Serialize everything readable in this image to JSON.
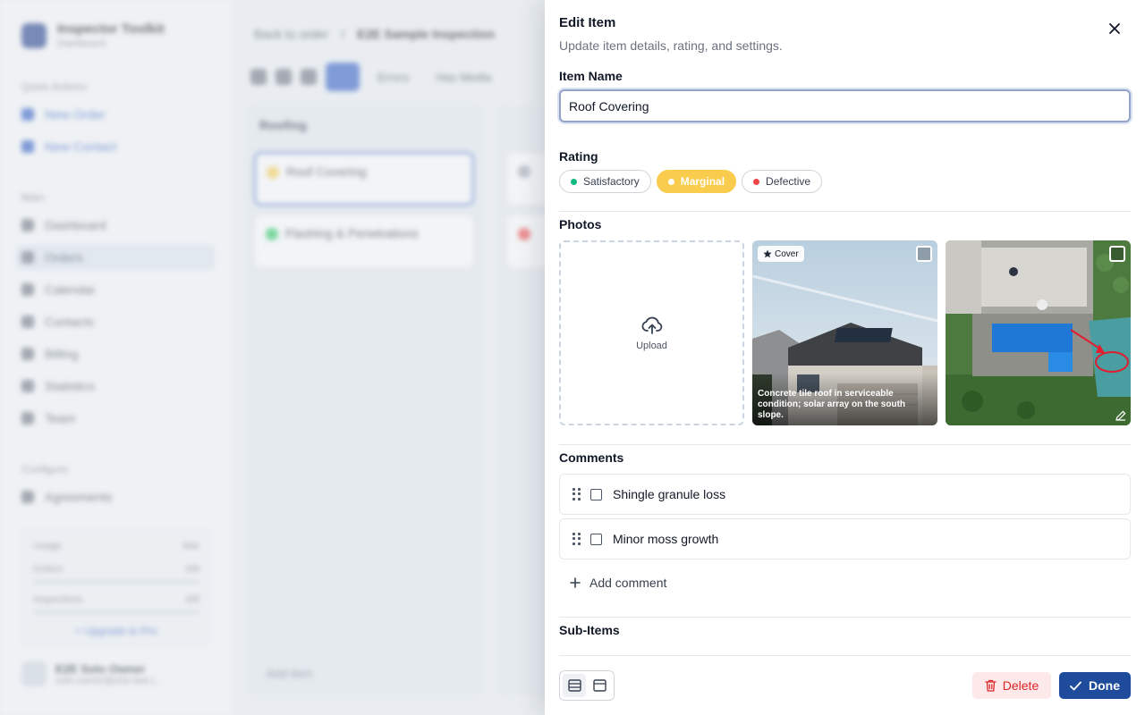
{
  "background": {
    "brand": {
      "title": "Inspector Toolkit",
      "subtitle": "Dashboard"
    },
    "quick_actions_label": "Quick Actions",
    "quick_actions": [
      "New Order",
      "New Contact"
    ],
    "main_label": "Main",
    "nav": [
      "Dashboard",
      "Orders",
      "Calendar",
      "Contacts",
      "Billing",
      "Statistics",
      "Team"
    ],
    "configure_label": "Configure",
    "configure": [
      "Agreements"
    ],
    "usage": {
      "label": "Usage",
      "period": "Mar",
      "rows": [
        [
          "Orders",
          "8/8"
        ],
        [
          "Inspections",
          "8/8"
        ]
      ],
      "upgrade": "+ Upgrade to Pro"
    },
    "user": {
      "name": "E2E Solo Owner",
      "email": "solo-owner@e2e-test.i..."
    },
    "breadcrumb": {
      "back": "Back to order",
      "current": "E2E Sample Inspection"
    },
    "toolbar": {
      "filters": "Errors",
      "media": "Has Media"
    },
    "columns": [
      {
        "title": "Roofing",
        "cards": [
          {
            "label": "Roof Covering",
            "color": "#facc4d"
          },
          {
            "label": "Flashing & Penetrations",
            "color": "#22c55e"
          }
        ]
      }
    ],
    "add_item": "Add item"
  },
  "drawer": {
    "title": "Edit Item",
    "subtitle": "Update item details, rating, and settings.",
    "item_name_label": "Item Name",
    "item_name_value": "Roof Covering",
    "rating_label": "Rating",
    "ratings": [
      {
        "label": "Satisfactory",
        "color": "#10b981",
        "active": false
      },
      {
        "label": "Marginal",
        "color": "#ffffff",
        "active": true
      },
      {
        "label": "Defective",
        "color": "#ef4444",
        "active": false
      }
    ],
    "photos_label": "Photos",
    "upload_label": "Upload",
    "cover_label": "Cover",
    "photo_caption": "Concrete tile roof in serviceable condition; solar array on the south slope.",
    "comments_label": "Comments",
    "comments": [
      "Shingle granule loss",
      "Minor moss growth"
    ],
    "add_comment_label": "Add comment",
    "sub_items_label": "Sub-Items",
    "delete_label": "Delete",
    "done_label": "Done"
  },
  "colors": {
    "primary": "#1e4b9c",
    "marginal": "#facc4d",
    "danger": "#dc2626"
  }
}
